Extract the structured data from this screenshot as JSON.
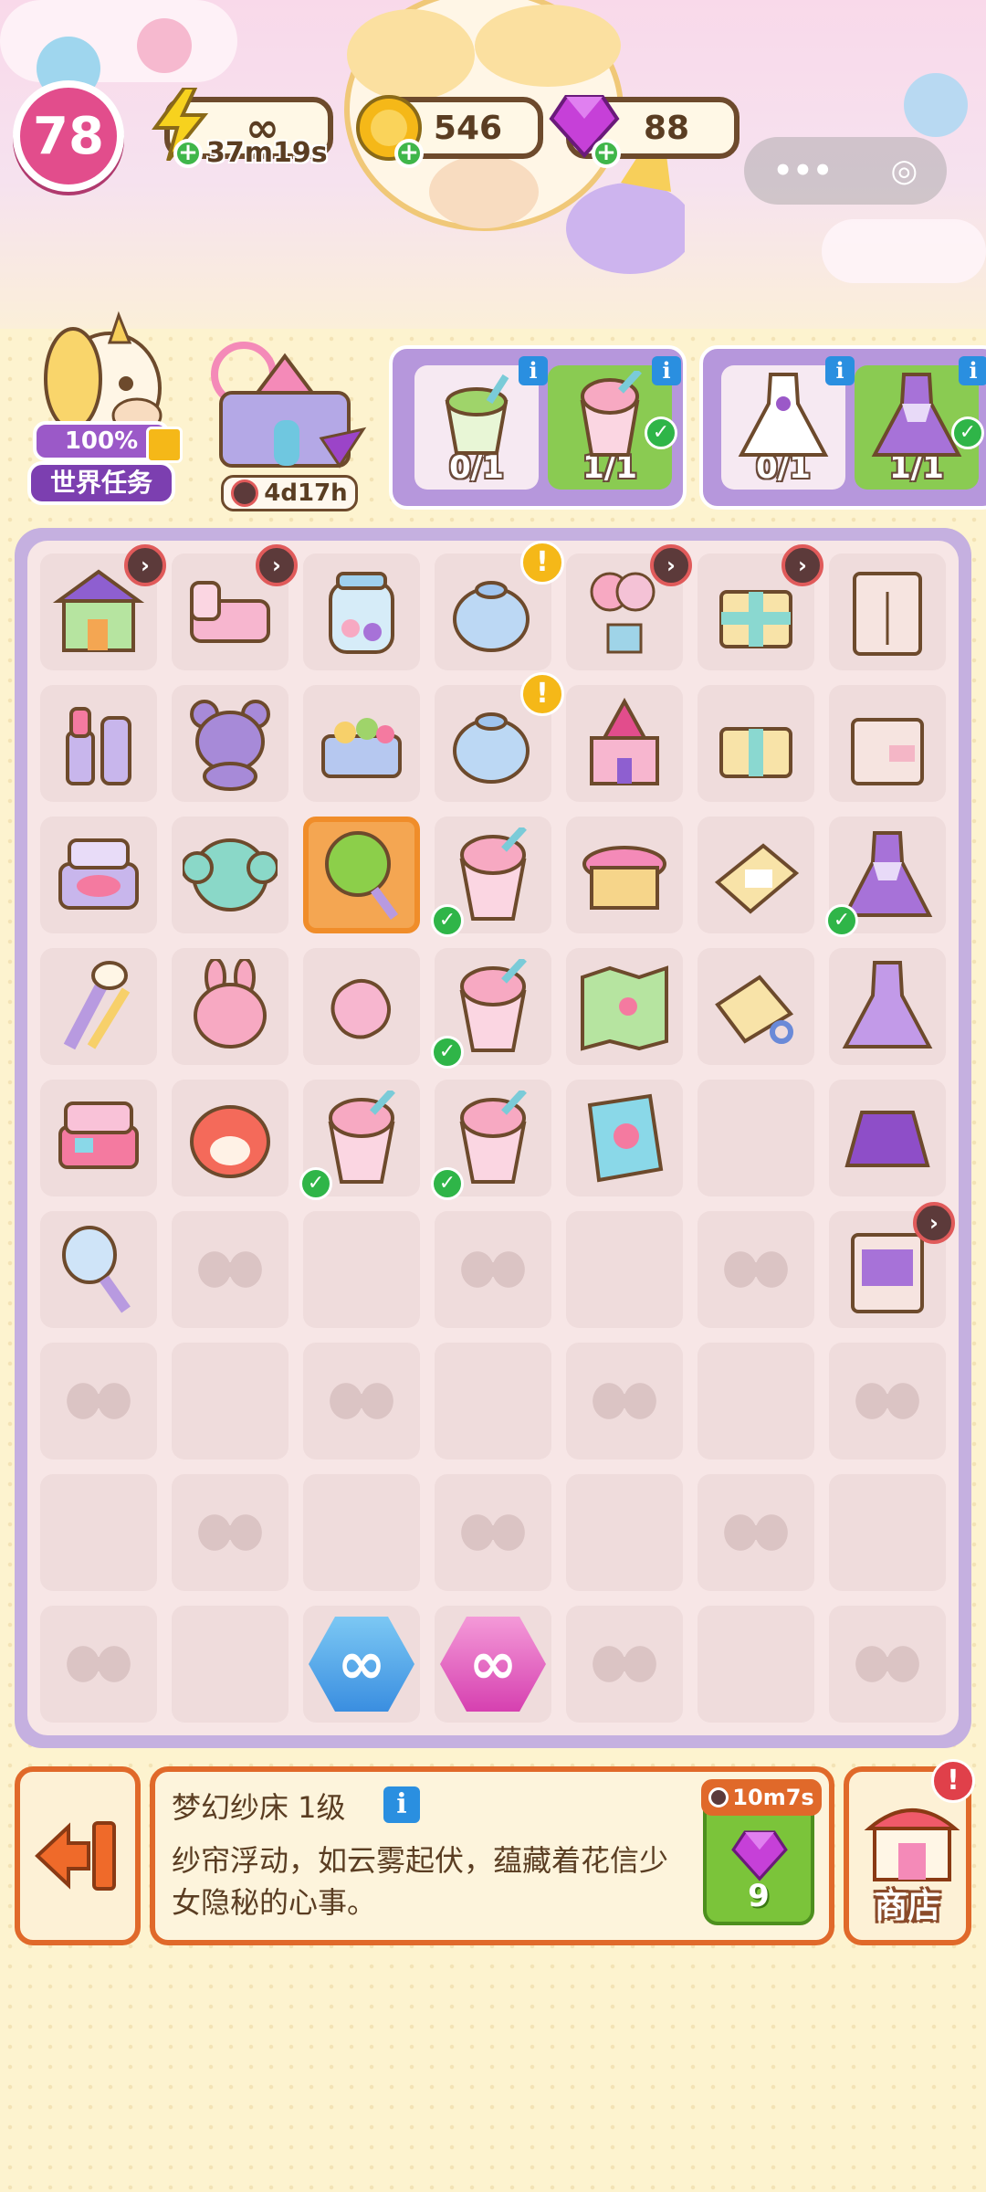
{
  "header": {
    "level": "78",
    "energy": {
      "value": "∞",
      "timer": "37m19s",
      "icon": "lightning-icon"
    },
    "coins": {
      "value": "546",
      "icon": "coin-icon"
    },
    "gems": {
      "value": "88",
      "icon": "gem-icon"
    },
    "capsule": {
      "more": "•••",
      "close": "◎"
    }
  },
  "world_task": {
    "percent": "100%",
    "label": "世界任务"
  },
  "event": {
    "timer": "4d17h"
  },
  "orders": [
    {
      "slots": [
        {
          "count": "0/1",
          "item": "green-smoothie"
        },
        {
          "count": "1/1",
          "item": "pink-milkshake",
          "done": true
        }
      ]
    },
    {
      "slots": [
        {
          "count": "0/1",
          "item": "white-dress"
        },
        {
          "count": "1/1",
          "item": "purple-dress",
          "done": true
        }
      ]
    }
  ],
  "board": {
    "selected_item": {
      "name": "梦幻纱床 1级",
      "description": "纱帘浮动，如云雾起伏，蕴藏着花信少女隐秘的心事。"
    }
  },
  "speedup": {
    "timer": "10m7s",
    "cost": "9"
  },
  "shop": {
    "label": "商店"
  },
  "colors": {
    "accent": "#e0692a",
    "board": "#c5b0e0",
    "level": "#e24d8c",
    "check": "#2fb548"
  }
}
